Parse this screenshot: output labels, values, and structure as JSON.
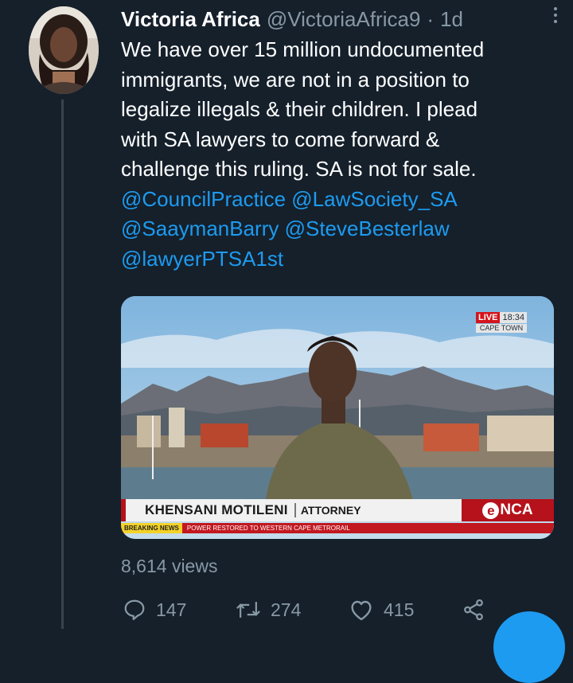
{
  "tweet": {
    "author": {
      "display_name": "Victoria Africa",
      "handle": "@VictoriaAfrica9",
      "separator": "·",
      "timestamp": "1d"
    },
    "text_lines": [
      "We have over 15 million undocumented",
      "immigrants, we are not in a position to",
      "legalize illegals & their children. I plead",
      "with SA lawyers to come forward &",
      "challenge this ruling. SA is not for sale."
    ],
    "mentions_lines": [
      [
        "@CouncilPractice",
        "@LawSociety_SA"
      ],
      [
        "@SaaymanBarry",
        "@SteveBesterlaw"
      ],
      [
        "@lawyerPTSA1st"
      ]
    ],
    "media": {
      "live_label": "LIVE",
      "live_time": "18:34",
      "live_city": "CAPE TOWN",
      "lower_third_name": "KHENSANI MOTILENI",
      "lower_third_title": "ATTORNEY",
      "channel_logo_e": "e",
      "channel_logo_rest": "NCA",
      "ticker_label": "BREAKING NEWS",
      "ticker_text": "POWER RESTORED TO WESTERN CAPE METRORAIL"
    },
    "views": "8,614 views",
    "actions": {
      "reply_icon": "reply-icon",
      "reply_count": "147",
      "retweet_icon": "retweet-icon",
      "retweet_count": "274",
      "like_icon": "heart-icon",
      "like_count": "415",
      "share_icon": "share-icon"
    }
  },
  "colors": {
    "background": "#15202b",
    "secondary_text": "#8899a6",
    "link": "#1d9bf0",
    "thread_line": "#38444d",
    "news_red": "#b5121b"
  }
}
